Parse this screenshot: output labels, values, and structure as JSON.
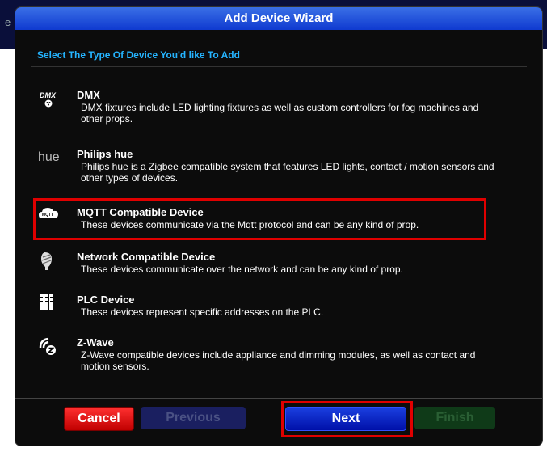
{
  "background": {
    "letter": "e"
  },
  "dialog": {
    "title": "Add Device Wizard",
    "subtitle": "Select The Type Of Device You'd like To Add"
  },
  "devices": [
    {
      "icon": "dmx-icon",
      "icon_text": "DMX",
      "title": "DMX",
      "desc": "DMX fixtures include LED lighting fixtures as well as custom controllers for fog machines and other props."
    },
    {
      "icon": "hue-icon",
      "icon_text": "hue",
      "title": "Philips hue",
      "desc": "Philips hue is a Zigbee compatible system that features LED lights, contact / motion sensors and other types of devices."
    },
    {
      "icon": "mqtt-icon",
      "icon_text": "MQTT",
      "title": "MQTT Compatible Device",
      "desc": "These devices communicate via the Mqtt protocol and can be any kind of prop."
    },
    {
      "icon": "network-icon",
      "title": "Network Compatible Device",
      "desc": "These devices communicate over the network and can be any kind of prop."
    },
    {
      "icon": "plc-icon",
      "title": "PLC Device",
      "desc": "These devices represent specific addresses on the PLC."
    },
    {
      "icon": "zwave-icon",
      "title": "Z-Wave",
      "desc": "Z-Wave compatible devices include appliance and dimming modules, as well as contact and motion sensors."
    }
  ],
  "buttons": {
    "cancel": "Cancel",
    "previous": "Previous",
    "next": "Next",
    "finish": "Finish"
  },
  "colors": {
    "title_bar": "#1f4ee0",
    "subtitle": "#25b4ff",
    "highlight": "#e00000",
    "cancel": "#e01010",
    "next": "#0a2ad0",
    "finish_disabled": "#0f3a18"
  }
}
